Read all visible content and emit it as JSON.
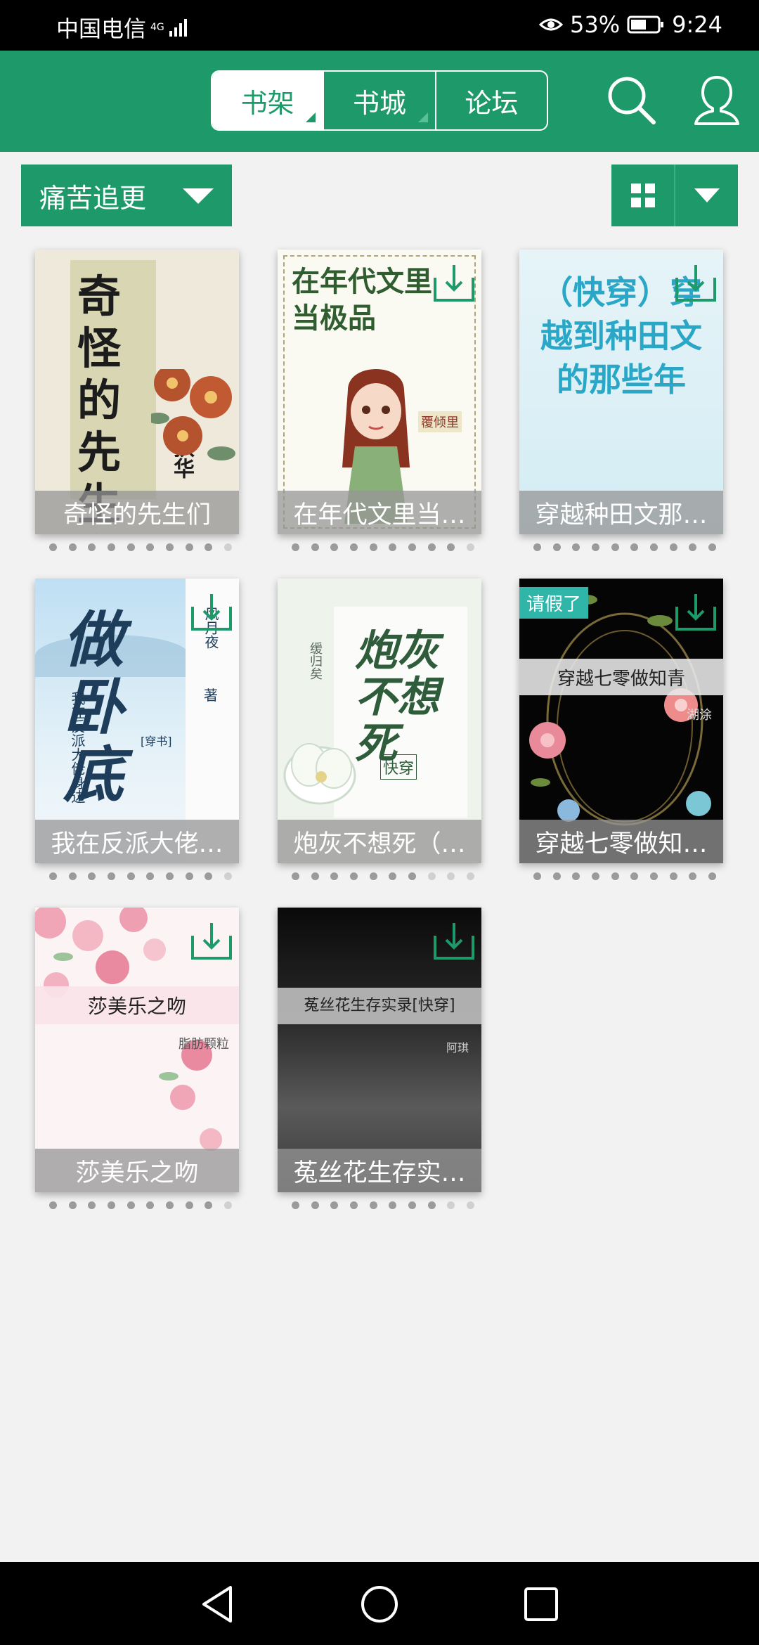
{
  "status": {
    "carrier": "中国电信",
    "network": "4G",
    "battery": "53%",
    "time": "9:24"
  },
  "tabs": [
    {
      "label": "书架",
      "active": true
    },
    {
      "label": "书城",
      "active": false
    },
    {
      "label": "论坛",
      "active": false
    }
  ],
  "filter": {
    "selected": "痛苦追更"
  },
  "colors": {
    "accent": "#1e9a6a",
    "background": "#f2f2f2"
  },
  "books": [
    {
      "caption": "奇怪的先生们",
      "cover_title": "奇怪的先生们",
      "author": "扶华",
      "downloaded": true,
      "progress_dots": 10,
      "read_dots": 9
    },
    {
      "caption": "在年代文里当…",
      "cover_title": "在年代文里当极品",
      "author": "覆倾里",
      "downloaded": false,
      "progress_dots": 10,
      "read_dots": 9
    },
    {
      "caption": "穿越种田文那…",
      "cover_title": "（快穿）穿越到种田文的那些年",
      "author": "",
      "downloaded": false,
      "progress_dots": 10,
      "read_dots": 10
    },
    {
      "caption": "我在反派大佬…",
      "cover_title": "做卧底",
      "subtitle": "我在反派大佬身边",
      "tag": "[穿书]",
      "author": "风月夜",
      "suffix": "著",
      "downloaded": false,
      "progress_dots": 10,
      "read_dots": 9
    },
    {
      "caption": "炮灰不想死（…",
      "cover_title": "炮灰不想死",
      "tag": "快穿",
      "author": "缓归矣",
      "downloaded": true,
      "progress_dots": 10,
      "read_dots": 7
    },
    {
      "caption": "穿越七零做知…",
      "cover_title": "穿越七零做知青",
      "badge": "请假了",
      "author": "湖涂",
      "downloaded": false,
      "progress_dots": 10,
      "read_dots": 10
    },
    {
      "caption": "莎美乐之吻",
      "cover_title": "莎美乐之吻",
      "author": "脂肪颗粒",
      "downloaded": false,
      "progress_dots": 10,
      "read_dots": 9
    },
    {
      "caption": "菟丝花生存实…",
      "cover_title": "菟丝花生存实录[快穿]",
      "author": "阿琪",
      "downloaded": false,
      "progress_dots": 10,
      "read_dots": 8
    }
  ]
}
